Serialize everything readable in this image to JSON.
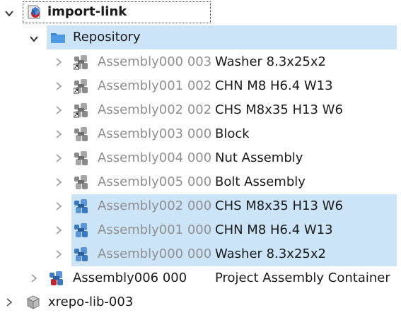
{
  "tree": {
    "root": {
      "label": "import-link"
    },
    "repository": {
      "label": "Repository"
    },
    "assemblies": [
      {
        "id": "Assembly000 003",
        "desc": "Washer 8.3x25x2"
      },
      {
        "id": "Assembly001 002",
        "desc": "CHN M8 H6.4 W13"
      },
      {
        "id": "Assembly002 002",
        "desc": "CHS M8x35 H13 W6"
      },
      {
        "id": "Assembly003 000",
        "desc": "Block"
      },
      {
        "id": "Assembly004 000",
        "desc": "Nut Assembly"
      },
      {
        "id": "Assembly005 000",
        "desc": "Bolt Assembly"
      },
      {
        "id": "Assembly002 000",
        "desc": "CHS M8x35 H13 W6"
      },
      {
        "id": "Assembly001 000",
        "desc": "CHN M8 H6.4 W13"
      },
      {
        "id": "Assembly000 000",
        "desc": "Washer 8.3x25x2"
      }
    ],
    "container": {
      "id": "Assembly006 000",
      "desc": "Project Assembly Container"
    },
    "lib": {
      "label": "xrepo-lib-003"
    }
  },
  "colors": {
    "selection": "#cce4f7",
    "folder": "#3b86d4",
    "muted_text": "#8f8f8f",
    "gray_icon": "#8a8a8a",
    "blue_icon": "#3a78c2"
  }
}
